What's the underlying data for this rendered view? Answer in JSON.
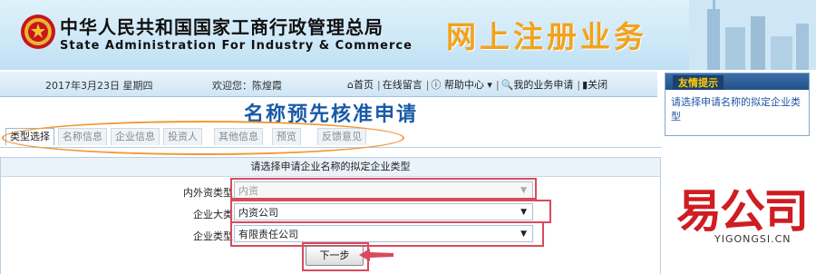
{
  "header": {
    "title_cn": "中华人民共和国国家工商行政管理总局",
    "title_en": "State Administration For Industry & Commerce",
    "service_title": "网上注册业务"
  },
  "navbar": {
    "date": "2017年3月23日 星期四",
    "welcome": "欢迎您：陈煌霞",
    "links": [
      {
        "label": "首页",
        "icon": "home-icon"
      },
      {
        "label": "在线留言",
        "icon": "message-icon"
      },
      {
        "label": "帮助中心 ▾",
        "icon": "info-icon"
      },
      {
        "label": "我的业务申请",
        "icon": "search-icon"
      },
      {
        "label": "关闭",
        "icon": "close-book-icon"
      }
    ]
  },
  "tip": {
    "title": "友情提示",
    "text": "请选择申请名称的拟定企业类型"
  },
  "page_title": "名称预先核准申请",
  "tabs": [
    {
      "label": "类型选择",
      "active": true
    },
    {
      "label": "名称信息",
      "active": false
    },
    {
      "label": "企业信息",
      "active": false
    },
    {
      "label": "投资人",
      "active": false
    },
    {
      "label": "其他信息",
      "active": false
    },
    {
      "label": "预览",
      "active": false
    },
    {
      "label": "反馈意见",
      "active": false
    }
  ],
  "form": {
    "heading": "请选择申请企业名称的拟定企业类型",
    "fields": [
      {
        "label": "内外资类型",
        "value": "内资",
        "disabled": true
      },
      {
        "label": "企业大类",
        "value": "内资公司",
        "disabled": false
      },
      {
        "label": "企业类型",
        "value": "有限责任公司",
        "disabled": false
      }
    ],
    "next_button": "下一步"
  },
  "watermark": {
    "logo_cn": "易公司",
    "logo_en": "YIGONGSI.CN"
  },
  "colors": {
    "title_blue": "#1a5aa8",
    "banner_orange": "#f3a21a",
    "highlight_red": "#d94a5c",
    "highlight_orange": "#ef9a37",
    "logo_red": "#cf1d22"
  }
}
